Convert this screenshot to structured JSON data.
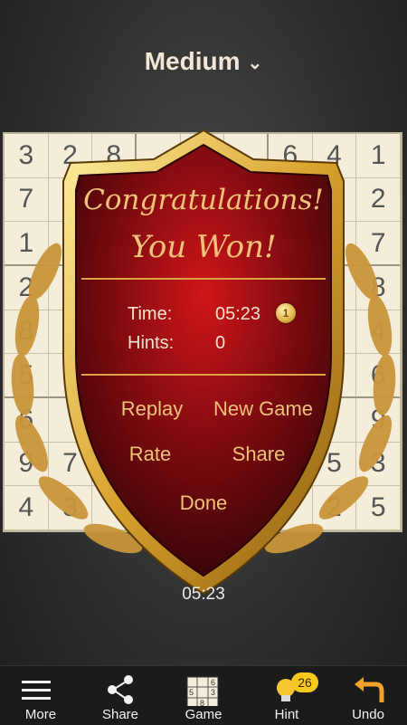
{
  "header": {
    "difficulty": "Medium"
  },
  "board": {
    "rows": [
      [
        "3",
        "2",
        "8",
        "",
        "",
        "",
        "6",
        "4",
        "1"
      ],
      [
        "7",
        "",
        "",
        "",
        "",
        "",
        "",
        "",
        "2"
      ],
      [
        "1",
        "",
        "",
        "",
        "",
        "",
        "",
        "",
        "7"
      ],
      [
        "2",
        "",
        "",
        "",
        "",
        "",
        "",
        "",
        "8"
      ],
      [
        "8",
        "",
        "",
        "",
        "",
        "",
        "",
        "",
        "4"
      ],
      [
        "5",
        "",
        "",
        "",
        "",
        "",
        "",
        "",
        "6"
      ],
      [
        "6",
        "",
        "",
        "",
        "",
        "",
        "",
        "",
        "9"
      ],
      [
        "9",
        "7",
        "",
        "",
        "",
        "",
        "",
        "5",
        "3"
      ],
      [
        "4",
        "3",
        "",
        "",
        "",
        "",
        "",
        "2",
        "5"
      ]
    ]
  },
  "dialog": {
    "title_line1": "Congratulations!",
    "title_line2": "You Won!",
    "time_label": "Time:",
    "time_value": "05:23",
    "hints_label": "Hints:",
    "hints_value": "0",
    "coin_value": "1",
    "replay": "Replay",
    "new_game": "New Game",
    "rate": "Rate",
    "share": "Share",
    "done": "Done"
  },
  "timer": "05:23",
  "bottom_nav": {
    "more": "More",
    "share": "Share",
    "game": "Game",
    "hint": "Hint",
    "hint_count": "26",
    "undo": "Undo"
  },
  "colors": {
    "gold": "#d9a441",
    "dialog_red": "#8f0f12",
    "badge": "#f6c91e"
  }
}
